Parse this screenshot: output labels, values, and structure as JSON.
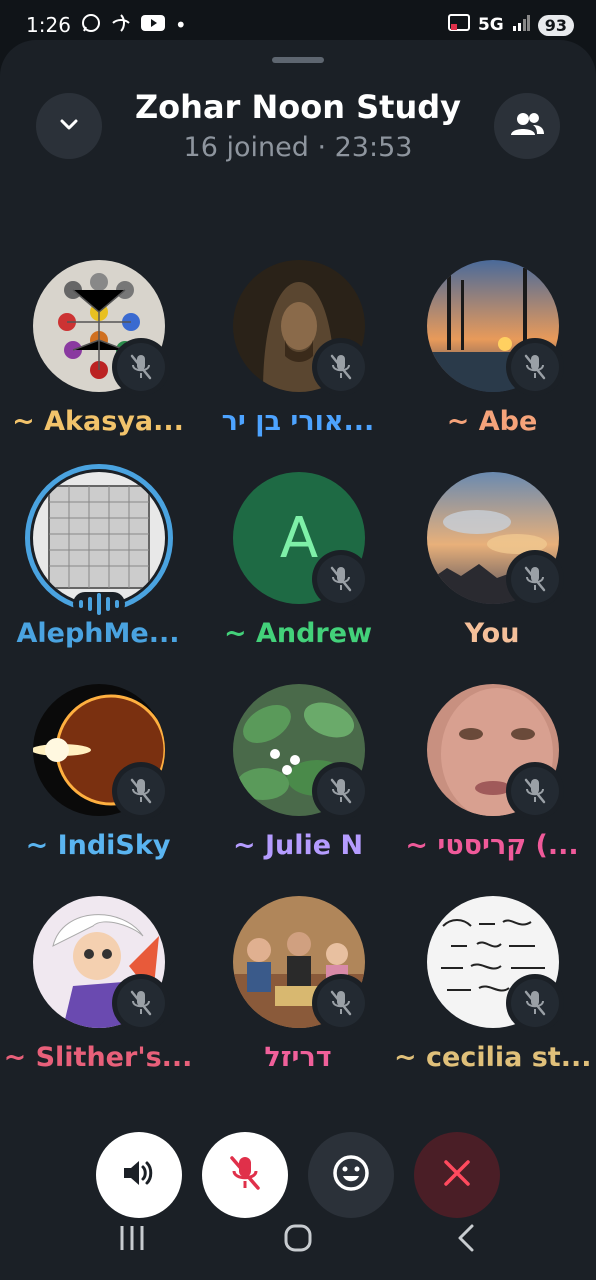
{
  "status_bar": {
    "time": "1:26",
    "network": "5G",
    "battery": "93",
    "dot": "•"
  },
  "header": {
    "title": "Zohar Noon Study",
    "subtitle": "16 joined · 23:53",
    "collapse_icon": "chevron-down-icon",
    "participants_icon": "people-icon"
  },
  "participants": [
    {
      "name": "~ Akasya...",
      "color": "#f2c36b",
      "muted": true,
      "avatar": "diagram"
    },
    {
      "name": "אורי בן יר...",
      "color": "#4da3ff",
      "muted": true,
      "avatar": "hooded"
    },
    {
      "name": "~ Abe",
      "color": "#f5a37a",
      "muted": true,
      "avatar": "sunset-trees"
    },
    {
      "name": "AlephMe...",
      "color": "#4aa3e0",
      "muted": false,
      "speaking": true,
      "avatar": "letters-grid"
    },
    {
      "name": "~ Andrew",
      "color": "#43d17a",
      "muted": true,
      "avatar": "letter",
      "initial": "A"
    },
    {
      "name": "You",
      "color": "#f5c09a",
      "muted": true,
      "avatar": "sky"
    },
    {
      "name": "~ IndiSky",
      "color": "#5ab4f0",
      "muted": true,
      "avatar": "eclipse"
    },
    {
      "name": "~ Julie N",
      "color": "#b59cff",
      "muted": true,
      "avatar": "plant"
    },
    {
      "name": "~ קריסטי (...",
      "color": "#f05a9a",
      "muted": true,
      "avatar": "face"
    },
    {
      "name": "~ Slither's...",
      "color": "#e8607a",
      "muted": true,
      "avatar": "anime"
    },
    {
      "name": "דריזל",
      "color": "#f0609a",
      "muted": true,
      "avatar": "family"
    },
    {
      "name": "~ cecilia st...",
      "color": "#e0c07a",
      "muted": true,
      "avatar": "quote"
    }
  ],
  "controls": {
    "speaker_icon": "speaker-icon",
    "mic_icon": "mic-off-icon",
    "emoji_icon": "emoji-icon",
    "leave_icon": "close-icon"
  },
  "colors": {
    "background": "#101418",
    "sheet": "#1b2026",
    "accent": "#4aa3e0",
    "mute_red": "#e0304a"
  }
}
